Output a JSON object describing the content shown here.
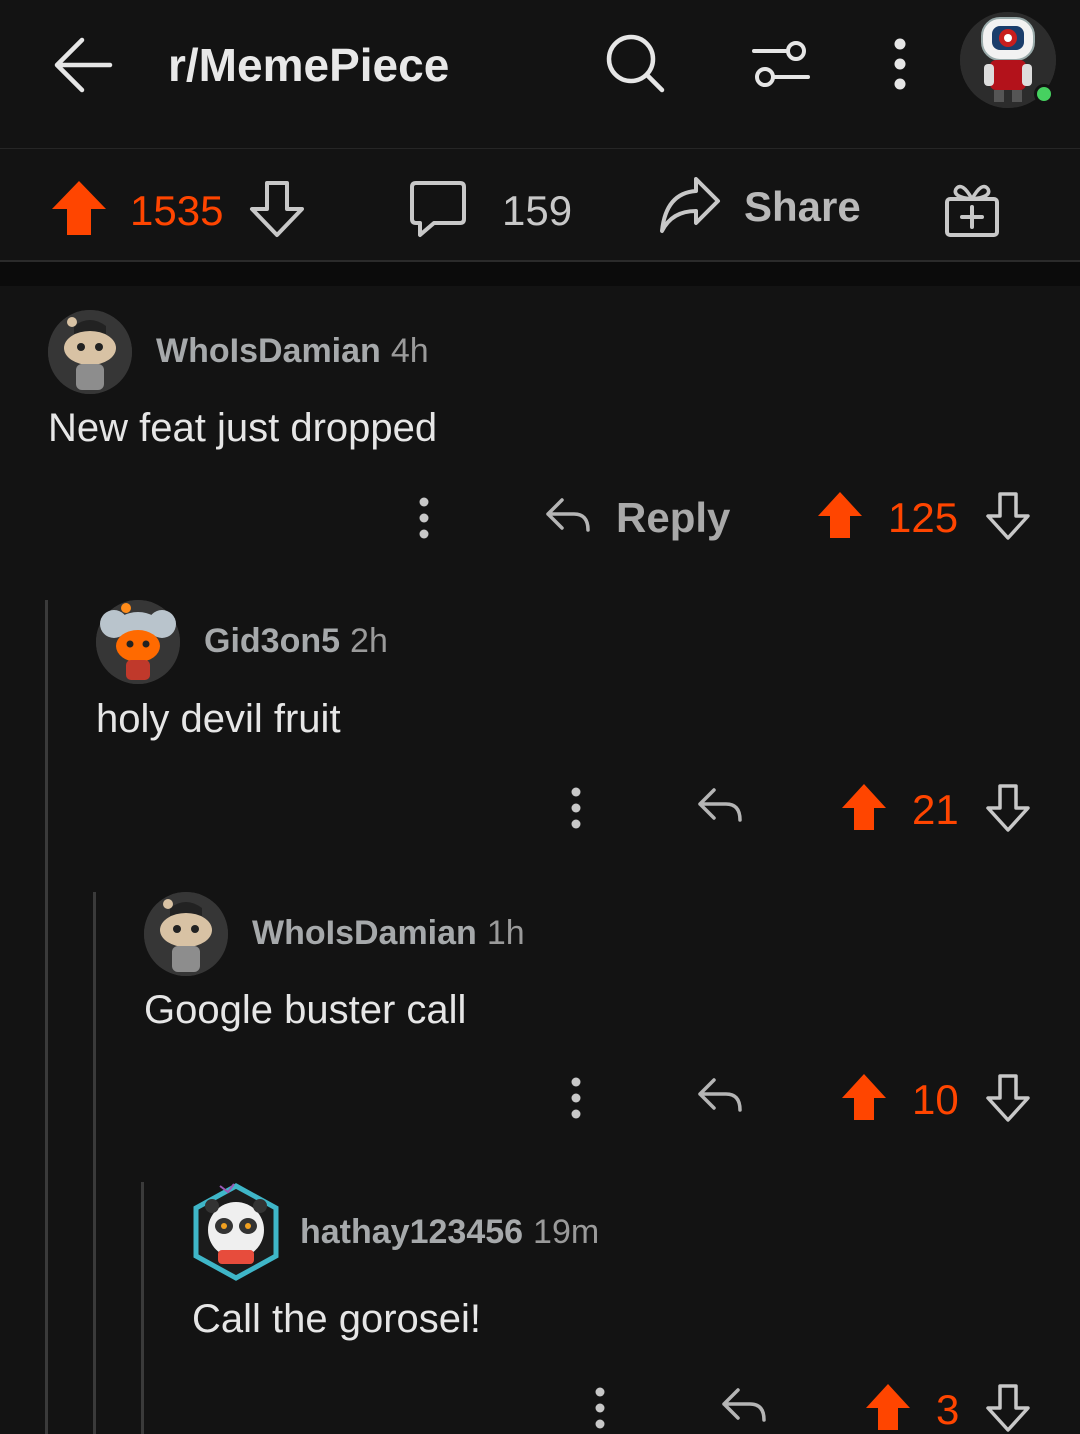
{
  "header": {
    "title": "r/MemePiece",
    "back_icon": "arrow-left-icon",
    "search_icon": "search-icon",
    "filter_icon": "sliders-icon",
    "more_icon": "vertical-dots-icon",
    "online_status_color": "#46d160"
  },
  "post_actions": {
    "upvotes": "1535",
    "comments": "159",
    "share_label": "Share",
    "award_icon": "gift-icon",
    "accent": "#ff4500"
  },
  "comments": [
    {
      "username": "WhoIsDamian",
      "time": "4h",
      "body": "New feat just dropped",
      "reply_label": "Reply",
      "votes": "125"
    },
    {
      "username": "Gid3on5",
      "time": "2h",
      "body": "holy devil fruit",
      "reply_label": "",
      "votes": "21"
    },
    {
      "username": "WhoIsDamian",
      "time": "1h",
      "body": "Google buster call",
      "reply_label": "",
      "votes": "10"
    },
    {
      "username": "hathay123456",
      "time": "19m",
      "body": "Call the gorosei!",
      "reply_label": "",
      "votes": "3"
    }
  ]
}
